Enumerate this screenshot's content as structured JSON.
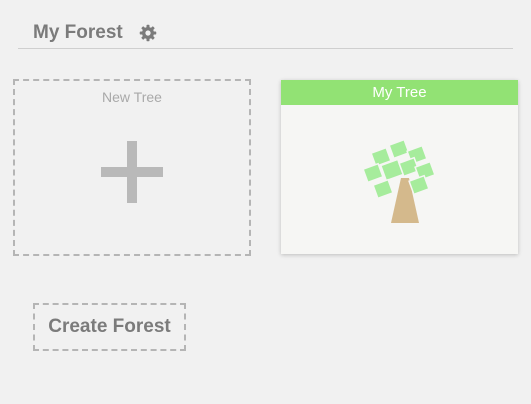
{
  "header": {
    "title": "My Forest",
    "settings_icon": "gear-icon"
  },
  "new_tree": {
    "label": "New Tree",
    "icon": "plus-icon"
  },
  "trees": [
    {
      "name": "My Tree",
      "icon": "tree-icon"
    }
  ],
  "actions": {
    "create_forest_label": "Create Forest"
  },
  "colors": {
    "background": "#f1f1f1",
    "tree_card_header": "#92e274",
    "tree_leaves": "#a6ec9c",
    "tree_trunk": "#d4b98c",
    "muted_text": "#7b7b7b",
    "dashed_border": "#b5b5b5"
  }
}
